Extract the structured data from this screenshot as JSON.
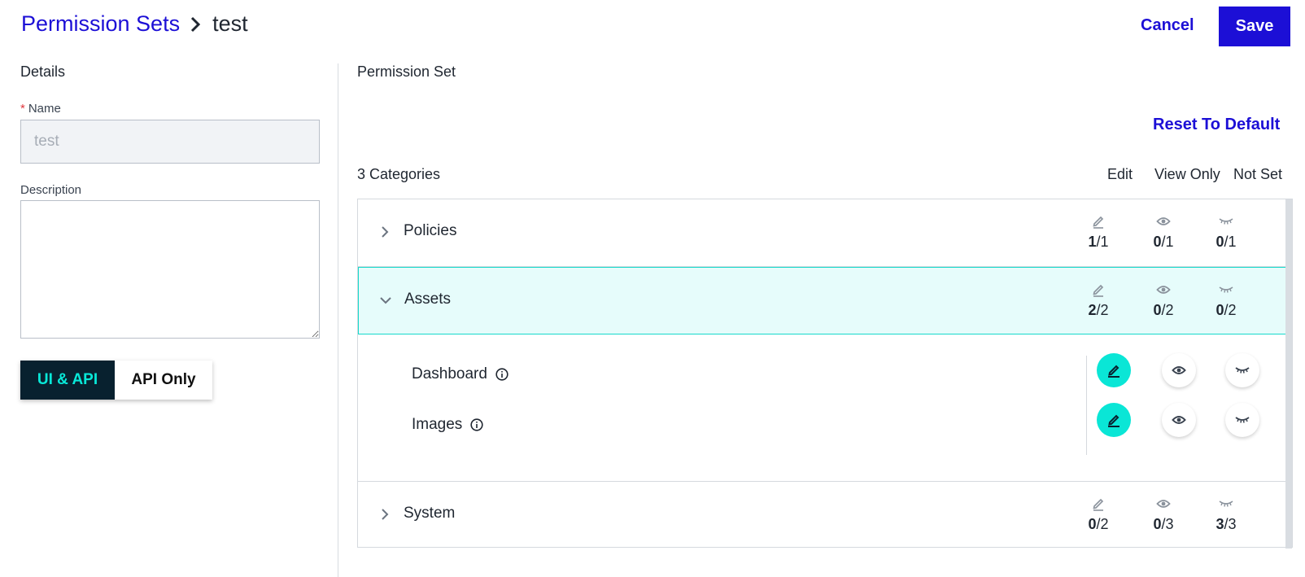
{
  "breadcrumb": {
    "parent": "Permission Sets",
    "current": "test"
  },
  "header": {
    "cancel_label": "Cancel",
    "save_label": "Save"
  },
  "details": {
    "title": "Details",
    "name_label": "Name",
    "name_value": "test",
    "description_label": "Description",
    "description_value": "",
    "toggle": {
      "active": "UI & API",
      "inactive": "API Only"
    }
  },
  "permission_set": {
    "title": "Permission Set",
    "reset_label": "Reset To Default",
    "categories_count": "3 Categories",
    "columns": [
      "Edit",
      "View Only",
      "Not Set"
    ],
    "categories": [
      {
        "label": "Policies",
        "expanded": false,
        "edit": [
          "1",
          "/1"
        ],
        "view": [
          "0",
          "/1"
        ],
        "notset": [
          "0",
          "/1"
        ]
      },
      {
        "label": "Assets",
        "expanded": true,
        "edit": [
          "2",
          "/2"
        ],
        "view": [
          "0",
          "/2"
        ],
        "notset": [
          "0",
          "/2"
        ],
        "items": [
          {
            "label": "Dashboard",
            "selected": "edit"
          },
          {
            "label": "Images",
            "selected": "edit"
          }
        ]
      },
      {
        "label": "System",
        "expanded": false,
        "edit": [
          "0",
          "/2"
        ],
        "view": [
          "0",
          "/3"
        ],
        "notset": [
          "3",
          "/3"
        ]
      }
    ]
  },
  "colors": {
    "accent": "#1c0fd6",
    "teal": "#0ae6d6",
    "dark": "#08212f"
  }
}
